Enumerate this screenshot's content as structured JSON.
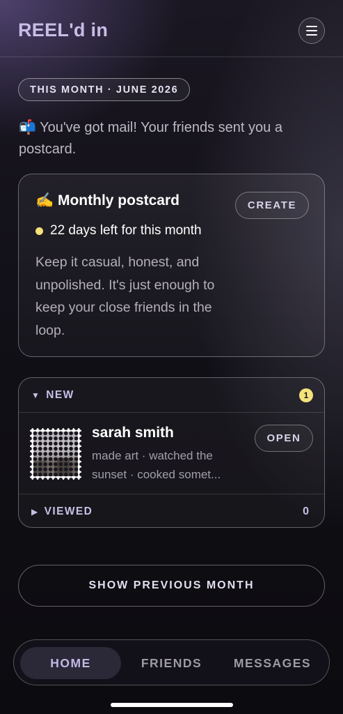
{
  "header": {
    "app_title": "REEL'd in",
    "menu_icon": "hamburger-menu-icon"
  },
  "month_pill": "THIS MONTH · JUNE 2026",
  "mail_message": "📬 You've got mail! Your friends sent you a postcard.",
  "postcard_card": {
    "title": "✍️ Monthly postcard",
    "create_label": "CREATE",
    "days_left": "22 days left for this month",
    "description": "Keep it casual, honest, and unpolished. It's just enough to keep your close friends in the loop."
  },
  "inbox": {
    "new_label": "NEW",
    "new_count": "1",
    "items": [
      {
        "name": "sarah smith",
        "summary": "made art · watched the sunset · cooked somet...",
        "open_label": "OPEN"
      }
    ],
    "viewed_label": "VIEWED",
    "viewed_count": "0"
  },
  "show_previous_label": "SHOW PREVIOUS MONTH",
  "nav": {
    "tabs": [
      "HOME",
      "FRIENDS",
      "MESSAGES"
    ],
    "active": "HOME"
  },
  "colors": {
    "accent": "#c7bde6",
    "status_dot": "#f4e27a",
    "background": "#0f0e13"
  }
}
